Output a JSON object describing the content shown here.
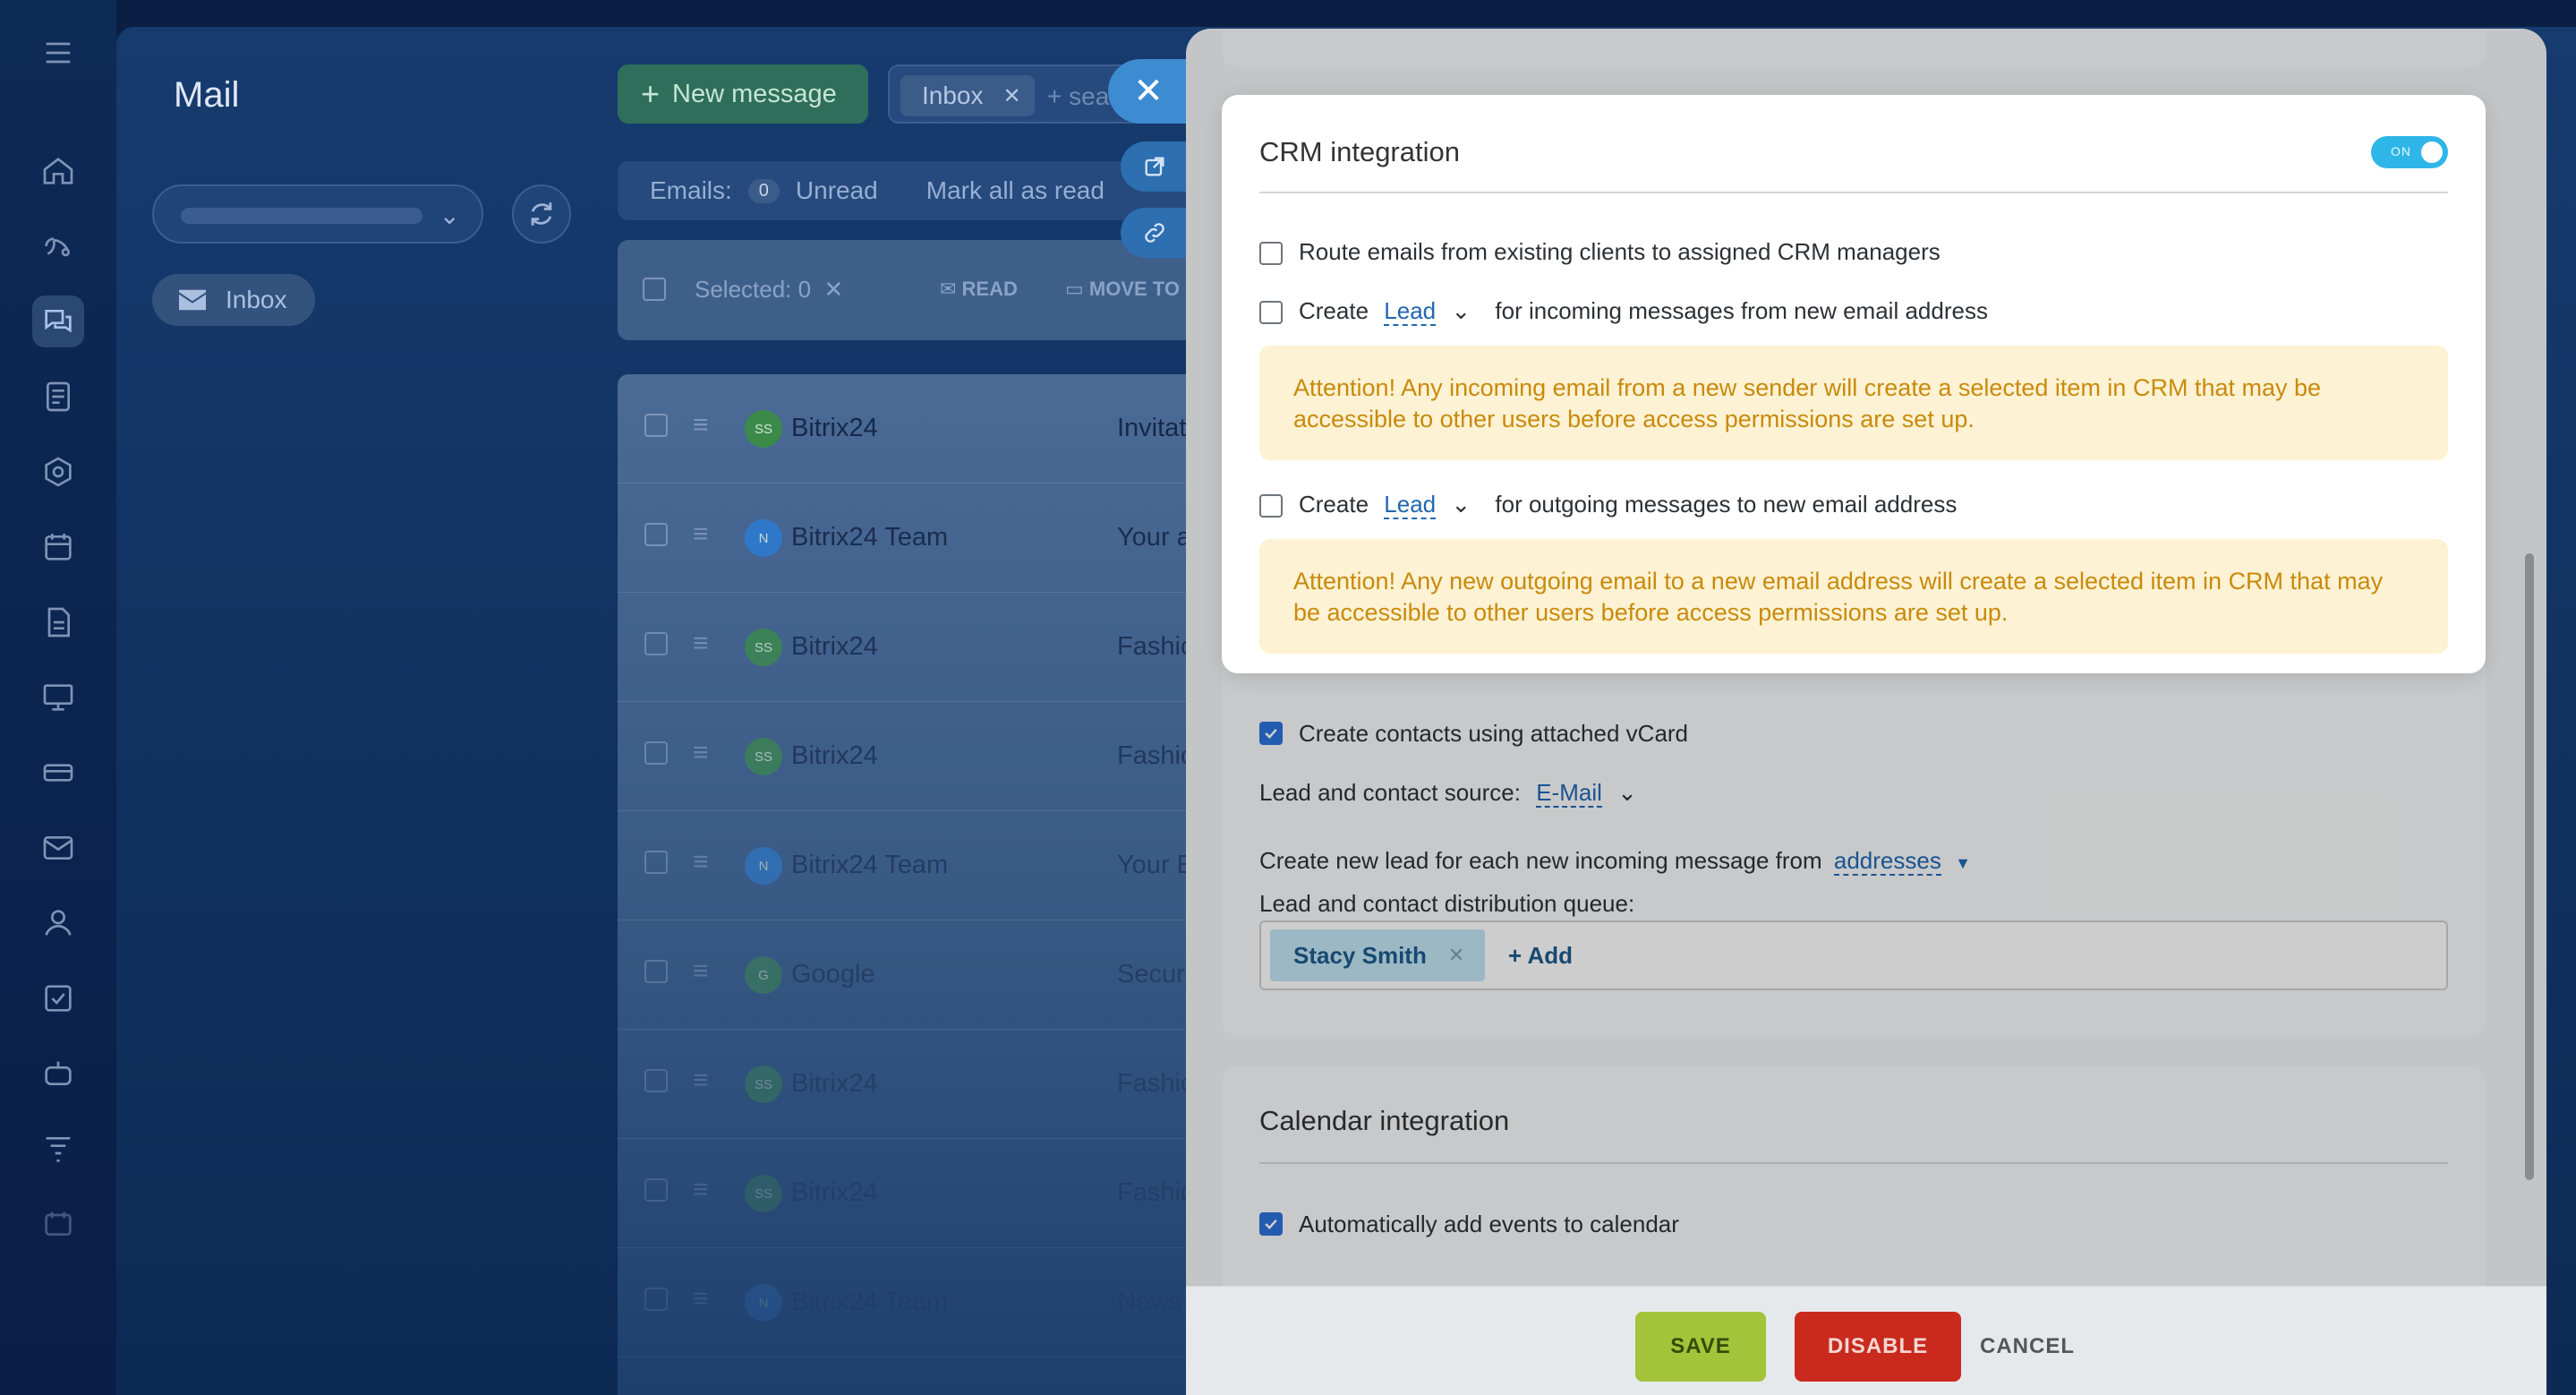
{
  "rail": {
    "icons": [
      "menu-icon",
      "home-icon",
      "feed-icon",
      "chat-icon",
      "tasks-icon",
      "sites-icon",
      "calendar-icon",
      "documents-icon",
      "workspace-icon",
      "inventory-icon",
      "mail-icon",
      "contacts-icon",
      "checklist-icon",
      "bot-icon",
      "filter-icon",
      "more-icon"
    ]
  },
  "mail": {
    "title": "Mail",
    "inbox_label": "Inbox",
    "new_message": "New message",
    "filter_chip": "Inbox",
    "search_placeholder": "+ sea",
    "emails_label": "Emails:",
    "unread_count": "0",
    "unread_label": "Unread",
    "mark_all_read": "Mark all as read",
    "selected": "Selected: 0",
    "action_read": "READ",
    "action_move": "MOVE TO",
    "rows": [
      {
        "sender": "Bitrix24",
        "initials": "SS",
        "subject": "Invitat",
        "avatar_color": "#3b8a4a"
      },
      {
        "sender": "Bitrix24 Team",
        "initials": "N",
        "subject": "Your a",
        "avatar_color": "#2d7bd0"
      },
      {
        "sender": "Bitrix24",
        "initials": "SS",
        "subject": "Fashic",
        "avatar_color": "#3b8a4a"
      },
      {
        "sender": "Bitrix24",
        "initials": "SS",
        "subject": "Fashic",
        "avatar_color": "#3b8a4a"
      },
      {
        "sender": "Bitrix24 Team",
        "initials": "N",
        "subject": "Your E",
        "avatar_color": "#2d7bd0"
      },
      {
        "sender": "Google",
        "initials": "G",
        "subject": "Secur",
        "avatar_color": "#3b8a4a"
      },
      {
        "sender": "Bitrix24",
        "initials": "SS",
        "subject": "Fashic",
        "avatar_color": "#3b8a4a"
      },
      {
        "sender": "Bitrix24",
        "initials": "SS",
        "subject": "Fashic",
        "avatar_color": "#3b8a4a"
      },
      {
        "sender": "Bitrix24 Team",
        "initials": "N",
        "subject": "News",
        "avatar_color": "#2d7bd0"
      }
    ]
  },
  "crm": {
    "title": "CRM integration",
    "toggle_label": "ON",
    "route_label": "Route emails from existing clients to assigned CRM managers",
    "create_label": "Create",
    "lead_label": "Lead",
    "incoming_suffix": "for incoming messages from new email address",
    "incoming_warning": "Attention! Any incoming email from a new sender will create a selected item in CRM that may be accessible to other users before access permissions are set up.",
    "outgoing_suffix": "for outgoing messages to new email address",
    "outgoing_warning": "Attention! Any new outgoing email to a new email address will create a selected item in CRM that may be accessible to other users before access permissions are set up.",
    "vcard_label": "Create contacts using attached vCard",
    "source_label": "Lead and contact source:",
    "source_value": "E-Mail",
    "new_lead_label": "Create new lead for each new incoming message from",
    "new_lead_value": "addresses",
    "queue_label": "Lead and contact distribution queue:",
    "queue_user": "Stacy Smith",
    "queue_add": "+ Add"
  },
  "calendar": {
    "title": "Calendar integration",
    "auto_add_label": "Automatically add events to calendar"
  },
  "footer": {
    "save": "SAVE",
    "disable": "DISABLE",
    "cancel": "CANCEL"
  },
  "colors": {
    "toggle_on": "#2fb6e8",
    "warning_bg": "#fdf2d3",
    "warning_text": "#c98a0c",
    "save": "#a3c33a",
    "disable": "#c92a1d",
    "link": "#2067b0"
  }
}
